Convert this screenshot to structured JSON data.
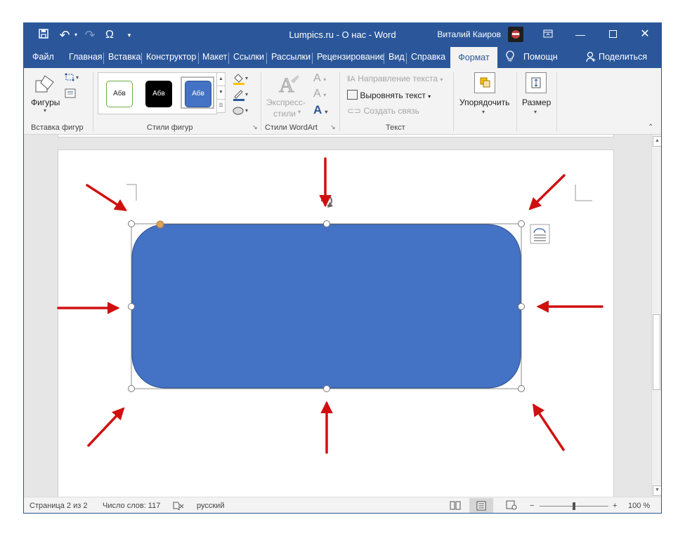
{
  "window": {
    "title": "Lumpics.ru - О нас  -  Word",
    "user_name": "Виталий Каиров",
    "accent_color": "#2b579a"
  },
  "quick_access": {
    "icons": [
      "save-icon",
      "undo-icon",
      "redo-icon",
      "omega-icon",
      "customize-icon"
    ],
    "undo_glyph": "↶",
    "redo_glyph": "↷",
    "omega_glyph": "Ω"
  },
  "tabs": [
    {
      "label": "Файл"
    },
    {
      "label": "Главная"
    },
    {
      "label": "Вставка"
    },
    {
      "label": "Конструктор"
    },
    {
      "label": "Макет"
    },
    {
      "label": "Ссылки"
    },
    {
      "label": "Рассылки"
    },
    {
      "label": "Рецензирование"
    },
    {
      "label": "Вид"
    },
    {
      "label": "Справка"
    }
  ],
  "active_tab": "Формат",
  "tell_me": "Помощн",
  "share": "Поделиться",
  "ribbon": {
    "insert_shapes": {
      "shapes_label": "Фигуры",
      "group_label": "Вставка фигур"
    },
    "shape_styles": {
      "group_label": "Стили фигур",
      "presets": [
        {
          "label": "Абв",
          "fill": "#ffffff",
          "border": "#70ad47",
          "text": "#222222"
        },
        {
          "label": "Абв",
          "fill": "#000000",
          "border": "#000000",
          "text": "#ffffff"
        },
        {
          "label": "Абв",
          "fill": "#4472c4",
          "border": "#2f528f",
          "text": "#ffffff"
        }
      ]
    },
    "wordart": {
      "express_line1": "Экспресс-",
      "express_line2": "стили",
      "group_label": "Стили WordArt"
    },
    "text": {
      "direction": "Направление текста",
      "align": "Выровнять текст",
      "link": "Создать связь",
      "group_label": "Текст"
    },
    "arrange": {
      "label": "Упорядочить"
    },
    "size": {
      "label": "Размер"
    }
  },
  "shape": {
    "fill": "#4472c4",
    "adjust_handle_color": "#d8a25a"
  },
  "annotation_color": "#d01010",
  "status": {
    "page": "Страница 2 из 2",
    "words": "Число слов: 117",
    "language": "русский",
    "zoom": "100 %"
  }
}
